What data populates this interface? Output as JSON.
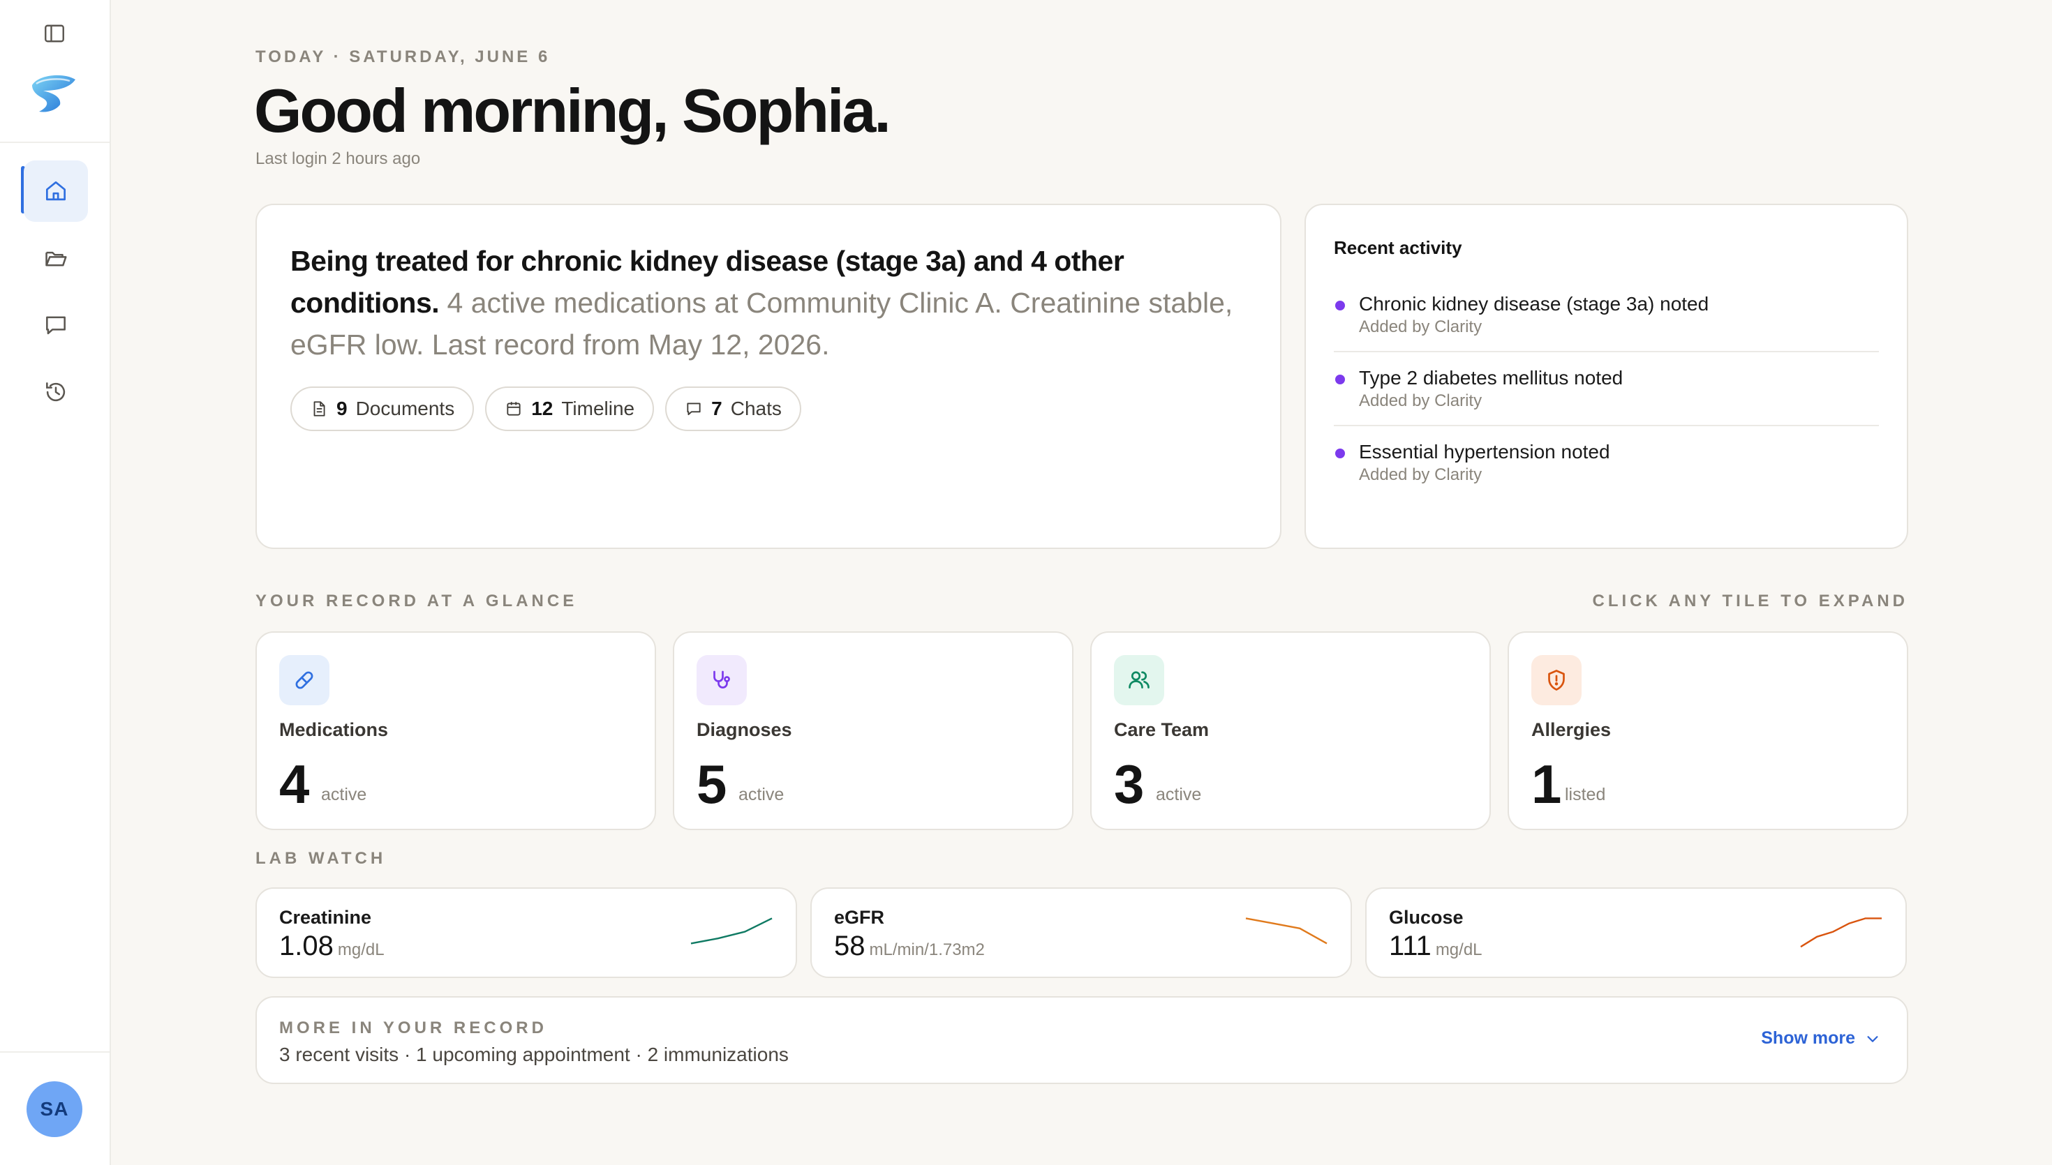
{
  "header": {
    "date_line": "TODAY · SATURDAY, JUNE 6",
    "greeting": "Good morning, Sophia.",
    "last_login": "Last login 2 hours ago"
  },
  "sidebar": {
    "icons": [
      "sidebar-toggle-icon",
      "logo",
      "home-icon",
      "folder-icon",
      "chat-icon",
      "history-icon"
    ],
    "avatar_initials": "SA",
    "accent_color": "#2f6fe0"
  },
  "summary": {
    "headline": "Being treated for chronic kidney disease (stage 3a) and 4 other conditions.",
    "detail": " 4 active medications at Community Clinic A. Creatinine stable, eGFR low. Last record from May 12, 2026.",
    "pills": [
      {
        "icon": "document-icon",
        "count": "9",
        "label": "Documents"
      },
      {
        "icon": "calendar-icon",
        "count": "12",
        "label": "Timeline"
      },
      {
        "icon": "chat-icon",
        "count": "7",
        "label": "Chats"
      }
    ]
  },
  "activity": {
    "title": "Recent activity",
    "items": [
      {
        "title": "Chronic kidney disease (stage 3a) noted",
        "sub": "Added by Clarity"
      },
      {
        "title": "Type 2 diabetes mellitus noted",
        "sub": "Added by Clarity"
      },
      {
        "title": "Essential hypertension noted",
        "sub": "Added by Clarity"
      }
    ],
    "dot_color": "#7c3aed"
  },
  "glance": {
    "label": "YOUR RECORD AT A GLANCE",
    "hint": "CLICK ANY TILE TO EXPAND",
    "tiles": [
      {
        "icon": "pill-icon",
        "name": "Medications",
        "count": "4",
        "unit": "active",
        "icon_bg": "#e6effc",
        "icon_color": "#2f6fe0"
      },
      {
        "icon": "stethoscope-icon",
        "name": "Diagnoses",
        "count": "5",
        "unit": "active",
        "icon_bg": "#f1eafd",
        "icon_color": "#7c3aed"
      },
      {
        "icon": "users-icon",
        "name": "Care Team",
        "count": "3",
        "unit": "active",
        "icon_bg": "#e3f6ee",
        "icon_color": "#0f8a63"
      },
      {
        "icon": "shield-alert-icon",
        "name": "Allergies",
        "count": "1",
        "unit": "listed",
        "icon_bg": "#fdebe0",
        "icon_color": "#d9540e"
      }
    ]
  },
  "labs": {
    "label": "LAB WATCH",
    "items": [
      {
        "name": "Creatinine",
        "value": "1.08",
        "unit": "mg/dL",
        "trend_color": "#0f7a63",
        "trend": [
          0.2,
          0.35,
          0.55,
          0.95
        ]
      },
      {
        "name": "eGFR",
        "value": "58",
        "unit": "mL/min/1.73m2",
        "trend_color": "#e07a1c",
        "trend": [
          0.95,
          0.8,
          0.65,
          0.2
        ]
      },
      {
        "name": "Glucose",
        "value": "111",
        "unit": "mg/dL",
        "trend_color": "#d9540e",
        "trend": [
          0.1,
          0.4,
          0.55,
          0.8,
          0.95,
          0.95
        ]
      }
    ]
  },
  "more": {
    "label": "MORE IN YOUR RECORD",
    "text": "3 recent visits · 1 upcoming appointment · 2 immunizations",
    "button": "Show more"
  }
}
